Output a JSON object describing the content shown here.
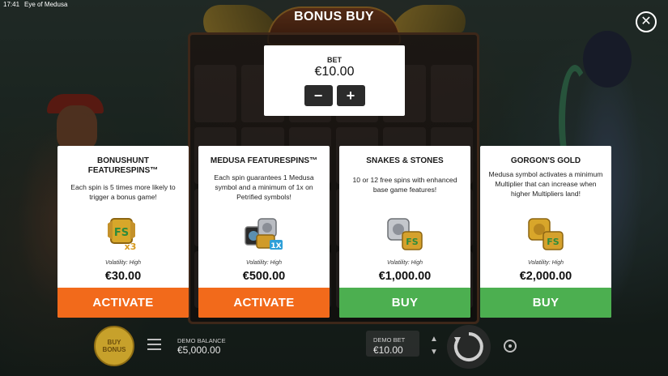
{
  "status_bar": {
    "time": "17:41",
    "app": "Eye of Medusa"
  },
  "dialog": {
    "title": "BONUS BUY",
    "close_icon": "close-icon",
    "bet": {
      "label": "BET",
      "value": "€10.00",
      "decrease": "−",
      "increase": "+"
    },
    "cards": [
      {
        "title": "BONUSHUNT FEATURESPINS™",
        "description": "Each spin is 5 times more likely to trigger a bonus game!",
        "icon": "fs-x3-symbol",
        "volatility": "Volatility: High",
        "price": "€30.00",
        "button": "ACTIVATE",
        "button_color": "#f26a1b"
      },
      {
        "title": "MEDUSA FEATURESPINS™",
        "description": "Each spin guarantees 1 Medusa symbol and a minimum of 1x on Petrified symbols!",
        "icon": "medusa-1x-symbol",
        "icon_badge": "1X",
        "volatility": "Volatility: High",
        "price": "€500.00",
        "button": "ACTIVATE",
        "button_color": "#f26a1b"
      },
      {
        "title": "SNAKES & STONES",
        "description": "10 or 12 free spins with enhanced base game features!",
        "icon": "stone-medusa-symbol",
        "volatility": "Volatility: High",
        "price": "€1,000.00",
        "button": "BUY",
        "button_color": "#4caf50"
      },
      {
        "title": "GORGON'S GOLD",
        "description": "Medusa symbol activates a minimum Multiplier that can increase when higher Multipliers land!",
        "icon": "gold-medusa-symbol",
        "volatility": "Volatility: High",
        "price": "€2,000.00",
        "button": "BUY",
        "button_color": "#4caf50"
      }
    ]
  },
  "bottom_bar": {
    "buy_bonus": "BUY BONUS",
    "menu_icon": "menu-icon",
    "demo_balance_label": "DEMO BALANCE",
    "demo_balance_value": "€5,000.00",
    "demo_bet_label": "DEMO BET",
    "demo_bet_value": "€10.00",
    "spin_icon": "spin-icon",
    "autoplay_icon": "autoplay-icon"
  }
}
